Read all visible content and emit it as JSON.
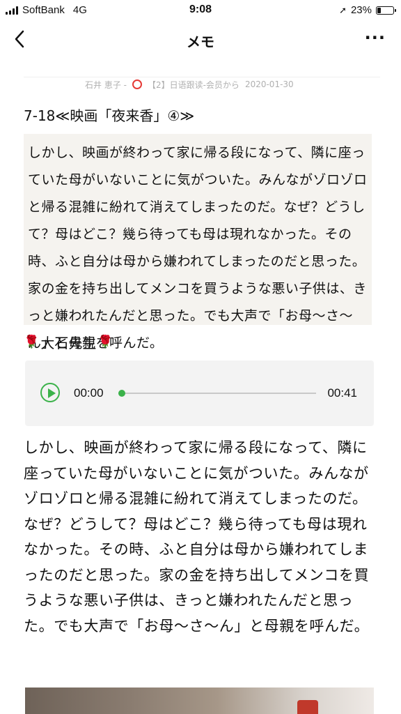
{
  "status": {
    "carrier": "SoftBank",
    "network": "4G",
    "time": "9:08",
    "battery": "23%",
    "battery_level": 0.23
  },
  "nav": {
    "title": "メモ",
    "back_icon": "chevron-left-icon",
    "more_icon": "ellipsis-icon"
  },
  "meta": {
    "author": "石井 恵子 -",
    "source": "【2】日语跟读-会员から",
    "date": "2020-01-30"
  },
  "article": {
    "title": "7-18≪映画「夜来香」④≫",
    "ruby_text": "しかし、映画が終わって家に帰る段になって、隣に座っていた母がいないことに気がついた。みんながゾロゾロと帰る混雑に紛れて消えてしまったのだ。なぜ？どうして？母はどこ？幾ら待っても母は現れなかった。その時、ふと自分は母から嫌われてしまったのだと思った。家の金を持ち出してメンコを買うような悪い子供は、きっと嫌われたんだと思った。でも大声で「お母〜さ〜ん」と母親を呼んだ。",
    "teacher": "大石先生",
    "rose_icon": "rose-icon"
  },
  "audio": {
    "current": "00:00",
    "total": "00:41",
    "progress": 0,
    "accent": "#3bb24a"
  },
  "body": {
    "text": "しかし、映画が終わって家に帰る段になって、隣に座っていた母がいないことに気がついた。みんながゾロゾロと帰る混雑に紛れて消えてしまったのだ。なぜ？どうして？母はどこ？幾ら待っても母は現れなかった。その時、ふと自分は母から嫌われてしまったのだと思った。家の金を持ち出してメンコを買うような悪い子供は、きっと嫌われたんだと思った。でも大声で「お母〜さ〜ん」と母親を呼んだ。"
  }
}
